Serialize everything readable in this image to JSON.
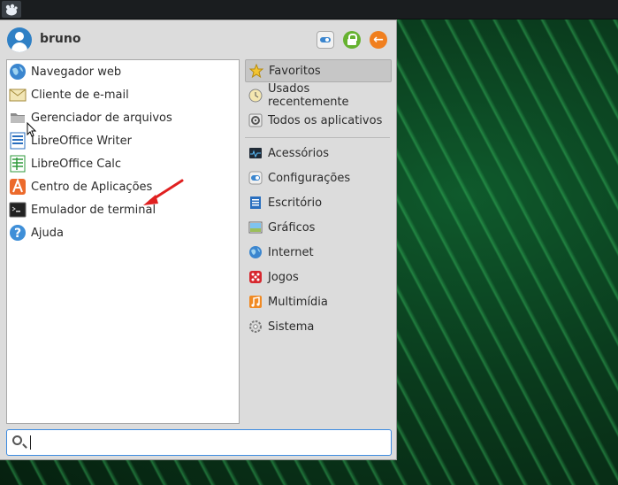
{
  "user": {
    "name": "bruno"
  },
  "header": {
    "settings_icon": "settings-toggle-icon",
    "lock_icon": "lock-icon",
    "logout_icon": "logout-arrow-icon",
    "logout_glyph": "←"
  },
  "favorites": [
    {
      "label": "Navegador web",
      "icon": "web-browser-globe-icon"
    },
    {
      "label": "Cliente de e-mail",
      "icon": "mail-envelope-icon"
    },
    {
      "label": "Gerenciador de arquivos",
      "icon": "folder-icon"
    },
    {
      "label": "LibreOffice Writer",
      "icon": "libreoffice-writer-icon"
    },
    {
      "label": "LibreOffice Calc",
      "icon": "libreoffice-calc-icon"
    },
    {
      "label": "Centro de Aplicações",
      "icon": "app-center-icon"
    },
    {
      "label": "Emulador de terminal",
      "icon": "terminal-icon"
    },
    {
      "label": "Ajuda",
      "icon": "help-icon"
    }
  ],
  "categories": {
    "top": [
      {
        "label": "Favoritos",
        "icon": "star-icon",
        "selected": true
      },
      {
        "label": "Usados recentemente",
        "icon": "clock-icon"
      },
      {
        "label": "Todos os aplicativos",
        "icon": "gear-icon"
      }
    ],
    "groups": [
      {
        "label": "Acessórios",
        "icon": "accessories-monitor-icon"
      },
      {
        "label": "Configurações",
        "icon": "settings-toggle-icon"
      },
      {
        "label": "Escritório",
        "icon": "office-document-icon"
      },
      {
        "label": "Gráficos",
        "icon": "graphics-image-icon"
      },
      {
        "label": "Internet",
        "icon": "internet-globe-icon"
      },
      {
        "label": "Jogos",
        "icon": "games-dice-icon"
      },
      {
        "label": "Multimídia",
        "icon": "multimedia-music-icon"
      },
      {
        "label": "Sistema",
        "icon": "system-gear-icon"
      }
    ]
  },
  "search": {
    "value": "",
    "placeholder": ""
  },
  "colors": {
    "accent": "#3b86cf",
    "lock": "#66b230",
    "logout": "#f07f1e",
    "annotation_arrow": "#e02020"
  }
}
